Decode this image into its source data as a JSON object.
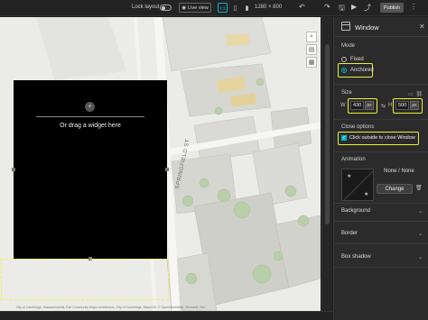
{
  "topbar": {
    "lock_label": "Lock layout",
    "live_label": "Live view",
    "resolution": "1280 × 800",
    "publish_label": "Publish",
    "accent": "#0ab3cf"
  },
  "canvas": {
    "widget_placeholder": "Or drag a widget here",
    "street_label": "SPRINGFIELD ST",
    "caption": "City of Cambridge, Massachusetts, Esri Community Maps contributors, City of Cambridge, MassGIS, © OpenStreetMap, Microsoft, Esri"
  },
  "panel": {
    "title": "Window",
    "mode": {
      "label": "Mode",
      "options": [
        {
          "label": "Fixed",
          "selected": false
        },
        {
          "label": "Anchored",
          "selected": true
        }
      ]
    },
    "size": {
      "label": "Size",
      "width_label": "W",
      "width_value": "430",
      "width_unit": "px",
      "height_label": "H",
      "height_value": "500",
      "height_unit": "px"
    },
    "close_options": {
      "label": "Close options",
      "checkbox_label": "Click outside to close Window",
      "checked": true
    },
    "animation": {
      "label": "Animation",
      "value": "None / None",
      "change_label": "Change"
    },
    "sections": [
      "Background",
      "Border",
      "Box shadow"
    ],
    "highlight_color": "#e8f23a"
  }
}
